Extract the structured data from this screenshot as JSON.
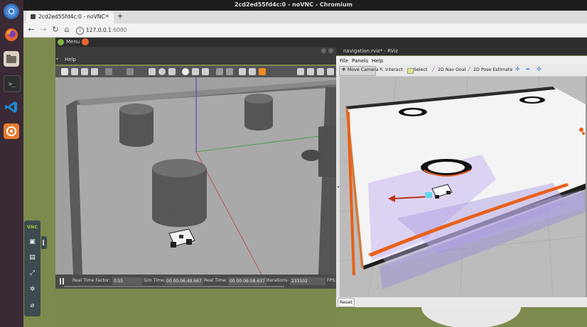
{
  "os": {
    "window_title": "2cd2ed55fd4c:0 - noVNC - Chromium",
    "dock_icons": [
      "chromium-icon",
      "firefox-icon",
      "files-icon",
      "terminal-icon",
      "vscode-icon",
      "ubuntu-software-icon"
    ]
  },
  "browser": {
    "tab_title": "2cd2ed55fd4c:0 - noVNC",
    "new_tab_label": "+",
    "url_host": "127.0.0.1",
    "url_port": ":6080"
  },
  "vnc": {
    "menu_label": "Menu",
    "logo_label": "VNC",
    "sidebar_icons": [
      "keyboard-icon",
      "clipboard-icon",
      "fullscreen-icon",
      "settings-icon",
      "disconnect-icon"
    ]
  },
  "gazebo": {
    "menu": {
      "help": "Help"
    },
    "status": {
      "rtf_label": "Real Time Factor:",
      "rtf_value": "0.55",
      "sim_label": "Sim Time:",
      "sim_value": "00 00:06:49.667",
      "real_label": "Real Time:",
      "real_value": "00 00:06:58.637",
      "iter_label": "Iterations:",
      "iter_value": "233102",
      "fps_label": "FPS:"
    }
  },
  "rviz": {
    "title": "navigation.rviz* - RViz",
    "menu": {
      "file": "File",
      "panels": "Panels",
      "help": "Help"
    },
    "tools": {
      "move_camera": "Move Camera",
      "interact": "Interact",
      "select": "Select",
      "nav_goal": "2D Nav Goal",
      "pose_estimate": "2D Pose Estimate"
    },
    "reset_label": "Reset"
  },
  "colors": {
    "dock_bg": "#3a2a35",
    "desktop_bg": "#7d8a4e",
    "gazebo_floor": "#a6a6a6",
    "rviz_map": "#f4f4f4",
    "laser": "#e8601a",
    "costmap": "#c8b8f0"
  }
}
